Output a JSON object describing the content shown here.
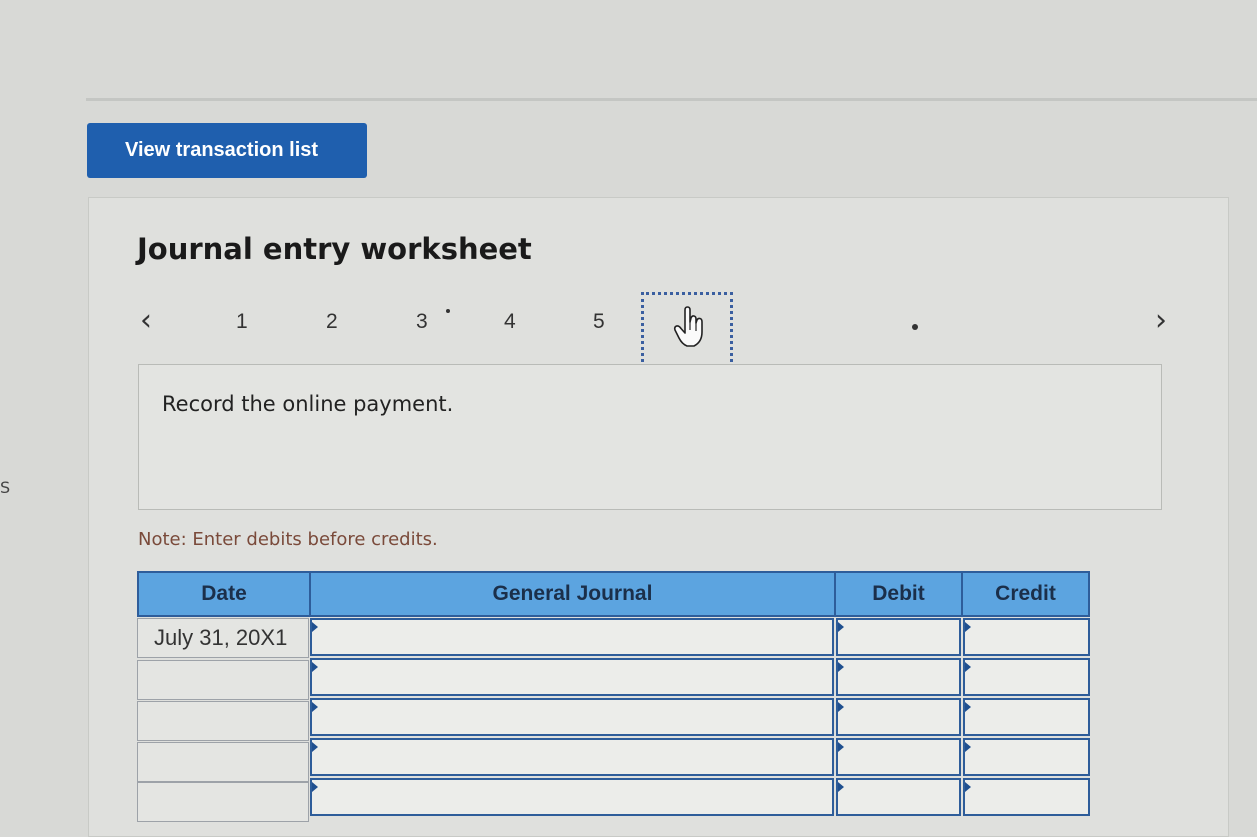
{
  "sidebar_fragment": "S",
  "toolbar": {
    "view_transaction_list": "View transaction list"
  },
  "worksheet": {
    "title": "Journal entry worksheet",
    "steps": [
      "1",
      "2",
      "3",
      "4",
      "5"
    ],
    "instruction": "Record the online payment.",
    "note": "Note: Enter debits before credits."
  },
  "journal": {
    "headers": {
      "date": "Date",
      "general_journal": "General Journal",
      "debit": "Debit",
      "credit": "Credit"
    },
    "rows": [
      {
        "date": "July 31, 20X1"
      },
      {
        "date": ""
      },
      {
        "date": ""
      },
      {
        "date": ""
      },
      {
        "date": ""
      }
    ]
  },
  "icons": {
    "prev": "chevron-left-icon",
    "next": "chevron-right-icon",
    "pointer": "hand-pointer-icon"
  },
  "colors": {
    "button": "#1f5fae",
    "table_header": "#5ca4e0",
    "border": "#2e5d9a",
    "note": "#7a4a3a"
  }
}
